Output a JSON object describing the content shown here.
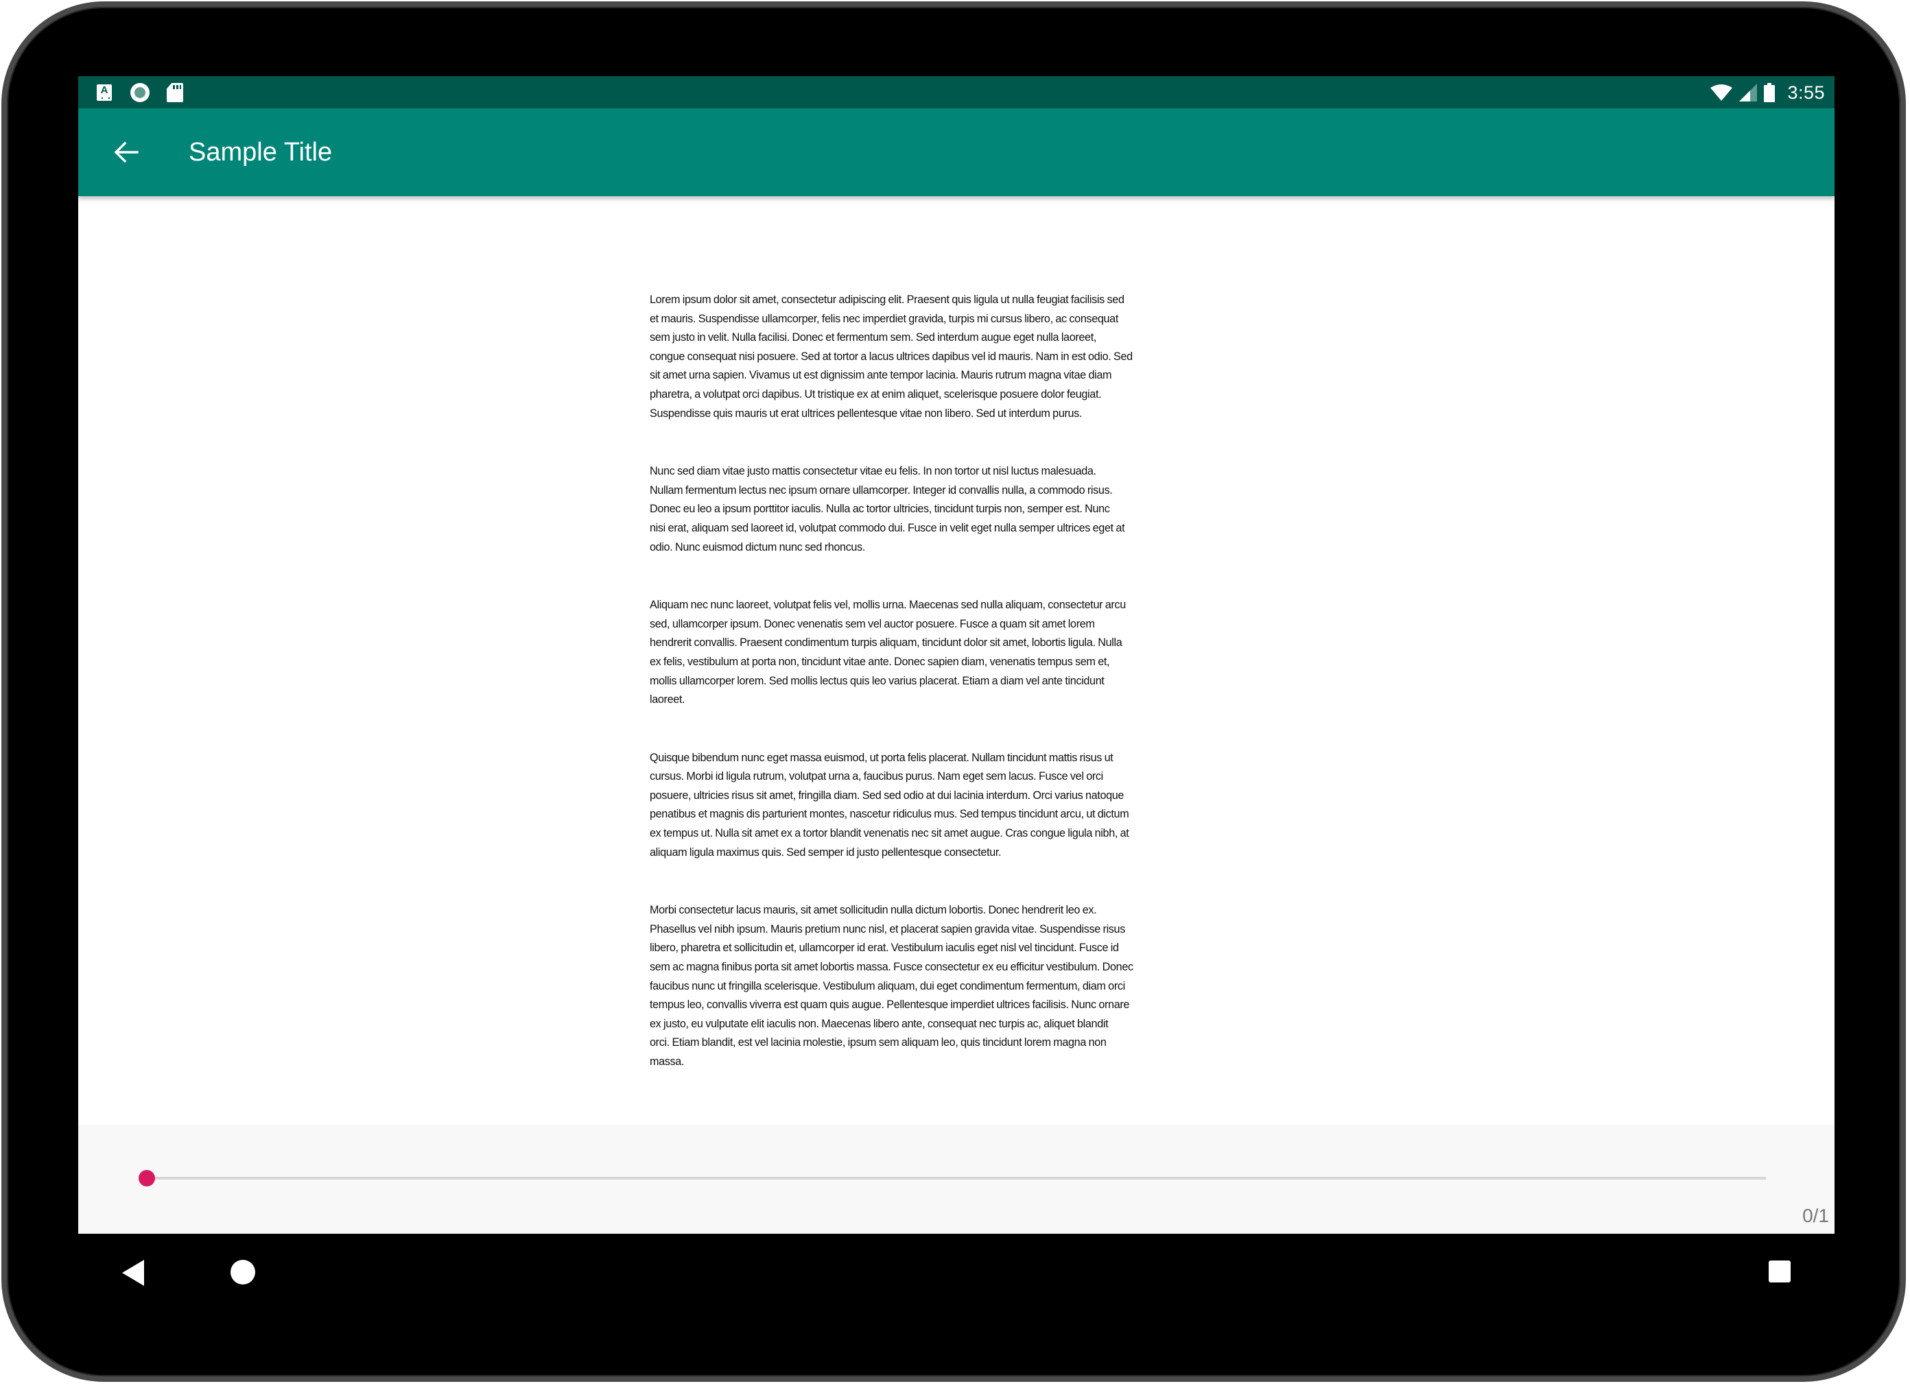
{
  "status_bar": {
    "left_icons": [
      "accessibility-a-icon",
      "screen-record-icon",
      "sd-card-icon"
    ],
    "right_icons": [
      "wifi-icon",
      "cell-signal-icon",
      "battery-icon"
    ],
    "time": "3:55",
    "color": "#00574b"
  },
  "app_bar": {
    "back_icon": "arrow-back-icon",
    "title": "Sample Title",
    "color": "#008577"
  },
  "document": {
    "paragraphs": [
      {
        "lines": [
          "Lorem ipsum dolor sit amet, consectetur adipiscing elit. Praesent quis ligula ut nulla feugiat facilisis sed",
          "et mauris. Suspendisse ullamcorper, felis nec imperdiet gravida, turpis mi cursus libero, ac consequat",
          "sem justo in velit. Nulla facilisi. Donec et fermentum sem. Sed interdum augue eget nulla laoreet,",
          "congue consequat nisi posuere. Sed at tortor a lacus ultrices dapibus vel id mauris. Nam in est odio. Sed",
          "sit amet urna sapien. Vivamus ut est dignissim ante tempor lacinia. Mauris rutrum magna vitae diam",
          "pharetra, a volutpat orci dapibus. Ut tristique ex at enim aliquet, scelerisque posuere dolor feugiat.",
          "Suspendisse quis mauris ut erat ultrices pellentesque vitae non libero. Sed ut interdum purus."
        ]
      },
      {
        "lines": [
          "Nunc sed diam vitae justo mattis consectetur vitae eu felis. In non tortor ut nisl luctus malesuada.",
          "Nullam fermentum lectus nec ipsum ornare ullamcorper. Integer id convallis nulla, a commodo risus.",
          "Donec eu leo a ipsum porttitor iaculis. Nulla ac tortor ultricies, tincidunt turpis non, semper est. Nunc",
          "nisi erat, aliquam sed laoreet id, volutpat commodo dui. Fusce in velit eget nulla semper ultrices eget at",
          "odio. Nunc euismod dictum nunc sed rhoncus."
        ]
      },
      {
        "lines": [
          "Aliquam nec nunc laoreet, volutpat felis vel, mollis urna. Maecenas sed nulla aliquam, consectetur arcu",
          "sed, ullamcorper ipsum. Donec venenatis sem vel auctor posuere. Fusce a quam sit amet lorem",
          "hendrerit convallis. Praesent condimentum turpis aliquam, tincidunt dolor sit amet, lobortis ligula. Nulla",
          "ex felis, vestibulum at porta non, tincidunt vitae ante. Donec sapien diam, venenatis tempus sem et,",
          "mollis ullamcorper lorem. Sed mollis lectus quis leo varius placerat. Etiam a diam vel ante tincidunt",
          "laoreet."
        ]
      },
      {
        "lines": [
          "Quisque bibendum nunc eget massa euismod, ut porta felis placerat. Nullam tincidunt mattis risus ut",
          "cursus. Morbi id ligula rutrum, volutpat urna a, faucibus purus. Nam eget sem lacus. Fusce vel orci",
          "posuere, ultricies risus sit amet, fringilla diam. Sed sed odio at dui lacinia interdum. Orci varius natoque",
          "penatibus et magnis dis parturient montes, nascetur ridiculus mus. Sed tempus tincidunt arcu, ut dictum",
          "ex tempus ut. Nulla sit amet ex a tortor blandit venenatis nec sit amet augue. Cras congue ligula nibh, at",
          "aliquam ligula maximus quis. Sed semper id justo pellentesque consectetur."
        ]
      },
      {
        "lines": [
          "Morbi consectetur lacus mauris, sit amet sollicitudin nulla dictum lobortis. Donec hendrerit leo ex.",
          "Phasellus vel nibh ipsum. Mauris pretium nunc nisl, et placerat sapien gravida vitae. Suspendisse risus",
          "libero, pharetra et sollicitudin et, ullamcorper id erat. Vestibulum iaculis eget nisl vel tincidunt. Fusce id",
          "sem ac magna finibus porta sit amet lobortis massa. Fusce consectetur ex eu efficitur vestibulum. Donec",
          "faucibus nunc ut fringilla scelerisque. Vestibulum aliquam, dui eget condimentum fermentum, diam orci",
          "tempus leo, convallis viverra est quam quis augue. Pellentesque imperdiet ultrices facilisis. Nunc ornare",
          "ex justo, eu vulputate elit iaculis non. Maecenas libero ante, consequat nec turpis ac, aliquet blandit",
          "orci. Etiam blandit, est vel lacinia molestie, ipsum sem aliquam leo, quis tincidunt lorem magna non",
          "massa."
        ]
      }
    ]
  },
  "page_seek": {
    "current_page": 0,
    "total_pages": 1,
    "progress": 0.0,
    "counter_text": "0/1",
    "thumb_color": "#d81b60",
    "track_color": "#d6d6d6"
  },
  "nav_bar": {
    "buttons": [
      "back-nav-icon",
      "home-nav-icon",
      "recents-nav-icon"
    ]
  }
}
